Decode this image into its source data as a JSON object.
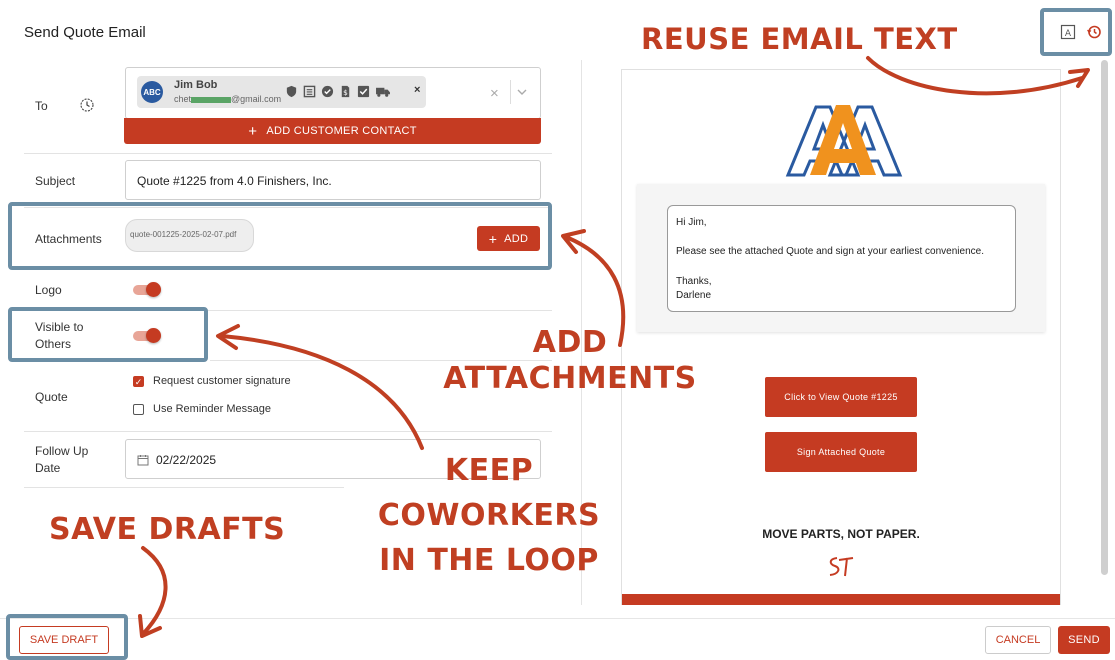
{
  "dialog": {
    "title": "Send Quote Email"
  },
  "fields": {
    "to_label": "To",
    "contact_name": "Jim Bob",
    "contact_email_prefix": "chet",
    "contact_email_suffix": "@gmail.com",
    "contact_avatar": "ABC",
    "add_contact_label": "ADD CUSTOMER CONTACT",
    "subject_label": "Subject",
    "subject_value": "Quote #1225 from 4.0 Finishers, Inc.",
    "attachments_label": "Attachments",
    "attachment_file": "quote-001225-2025-02-07.pdf",
    "add_label": "ADD",
    "logo_label": "Logo",
    "visible_label_1": "Visible to",
    "visible_label_2": "Others",
    "quote_label": "Quote",
    "request_signature_label": "Request customer signature",
    "reminder_label": "Use Reminder Message",
    "followup_label_1": "Follow Up",
    "followup_label_2": "Date",
    "followup_value": "02/22/2025"
  },
  "preview": {
    "greeting": "Hi Jim,",
    "body": "Please see the attached Quote and sign at your earliest convenience.",
    "closing": "Thanks,",
    "signature": "Darlene",
    "view_button": "Click to View Quote #1225",
    "sign_button": "Sign Attached Quote",
    "tagline": "MOVE PARTS, NOT PAPER.",
    "brand_colors": {
      "accent": "#c53b22",
      "logo_blue": "#2a5aa0",
      "logo_orange": "#f0921e"
    }
  },
  "footer": {
    "save_draft": "SAVE DRAFT",
    "cancel": "CANCEL",
    "send": "SEND"
  },
  "callouts": {
    "reuse": "REUSE EMAIL TEXT",
    "attachments_1": "ADD",
    "attachments_2": "ATTACHMENTS",
    "coworkers_1": "KEEP COWORKERS",
    "coworkers_2": "IN THE LOOP",
    "drafts": "SAVE DRAFTS"
  },
  "icons": [
    "history-icon",
    "template-icon",
    "clock-icon",
    "calendar-icon",
    "plus-icon",
    "close-icon",
    "chevron-down-icon"
  ]
}
